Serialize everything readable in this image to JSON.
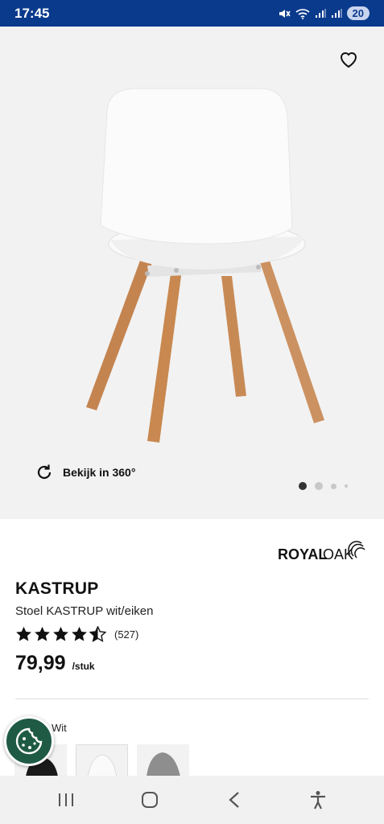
{
  "status_bar": {
    "time": "17:45",
    "battery": "20"
  },
  "gallery": {
    "view_360_label": "Bekijk in 360°",
    "pagination_count": 4,
    "active_index": 0
  },
  "brand": {
    "name_part1": "ROYAL",
    "name_part2": "OAK"
  },
  "product": {
    "title": "KASTRUP",
    "subtitle": "Stoel KASTRUP wit/eiken",
    "rating": 4.5,
    "review_count": "(527)",
    "price": "79,99",
    "price_unit": "/stuk"
  },
  "color": {
    "label": "Wit"
  },
  "colors": {
    "accent_blue": "#0a3a8c",
    "cookie_green": "#1f5a44",
    "wood": "#c88a55"
  },
  "icons": {
    "favorite": "heart-outline-icon",
    "rotate": "rotate-360-icon",
    "cookie": "cookie-settings-icon",
    "nav_recents": "recents-icon",
    "nav_home": "home-icon",
    "nav_back": "back-icon",
    "nav_accessibility": "accessibility-icon"
  }
}
